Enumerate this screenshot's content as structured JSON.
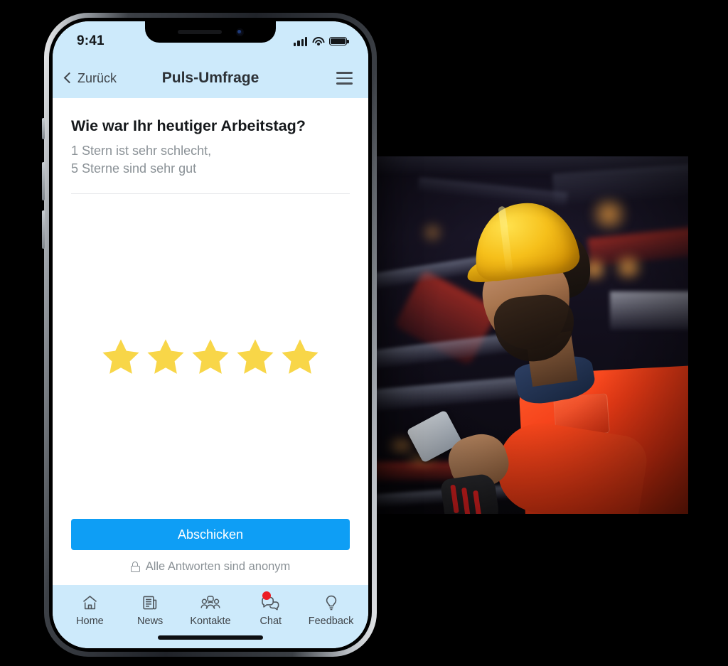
{
  "phone": {
    "status_bar": {
      "time": "9:41",
      "signal_icon": "signal-bars-icon",
      "wifi_icon": "wifi-icon",
      "battery_icon": "battery-full-icon"
    },
    "navbar": {
      "back_label": "Zurück",
      "back_icon": "chevron-left-icon",
      "title": "Puls-Umfrage",
      "menu_icon": "hamburger-menu-icon"
    },
    "survey": {
      "question": "Wie war Ihr heutiger Arbeitstag?",
      "hint_line1": "1 Stern ist sehr schlecht,",
      "hint_line2": "5 Sterne sind sehr gut",
      "rating": {
        "max": 5,
        "selected": 5,
        "star_color": "#f8d648",
        "stars": [
          1,
          2,
          3,
          4,
          5
        ]
      },
      "submit_label": "Abschicken",
      "submit_color": "#0e9ef5",
      "anonymous_note": "Alle Antworten sind anonym",
      "anonymous_icon": "lock-icon"
    },
    "tabbar": {
      "items": [
        {
          "label": "Home",
          "icon": "home-icon",
          "badge": null
        },
        {
          "label": "News",
          "icon": "newspaper-icon",
          "badge": null
        },
        {
          "label": "Kontakte",
          "icon": "people-group-icon",
          "badge": null
        },
        {
          "label": "Chat",
          "icon": "chat-bubbles-icon",
          "badge": "dot"
        },
        {
          "label": "Feedback",
          "icon": "lightbulb-icon",
          "badge": null
        }
      ],
      "badge_color": "#ec1c24",
      "background_color": "#cdeafb"
    }
  },
  "photo": {
    "alt": "Industriearbeiter mit gelbem Schutzhelm und roter Arbeitskleidung bedient ein Smartphone in einer Lagerhalle",
    "helmet_color": "#f6c01b",
    "suit_color": "#f23c16"
  }
}
